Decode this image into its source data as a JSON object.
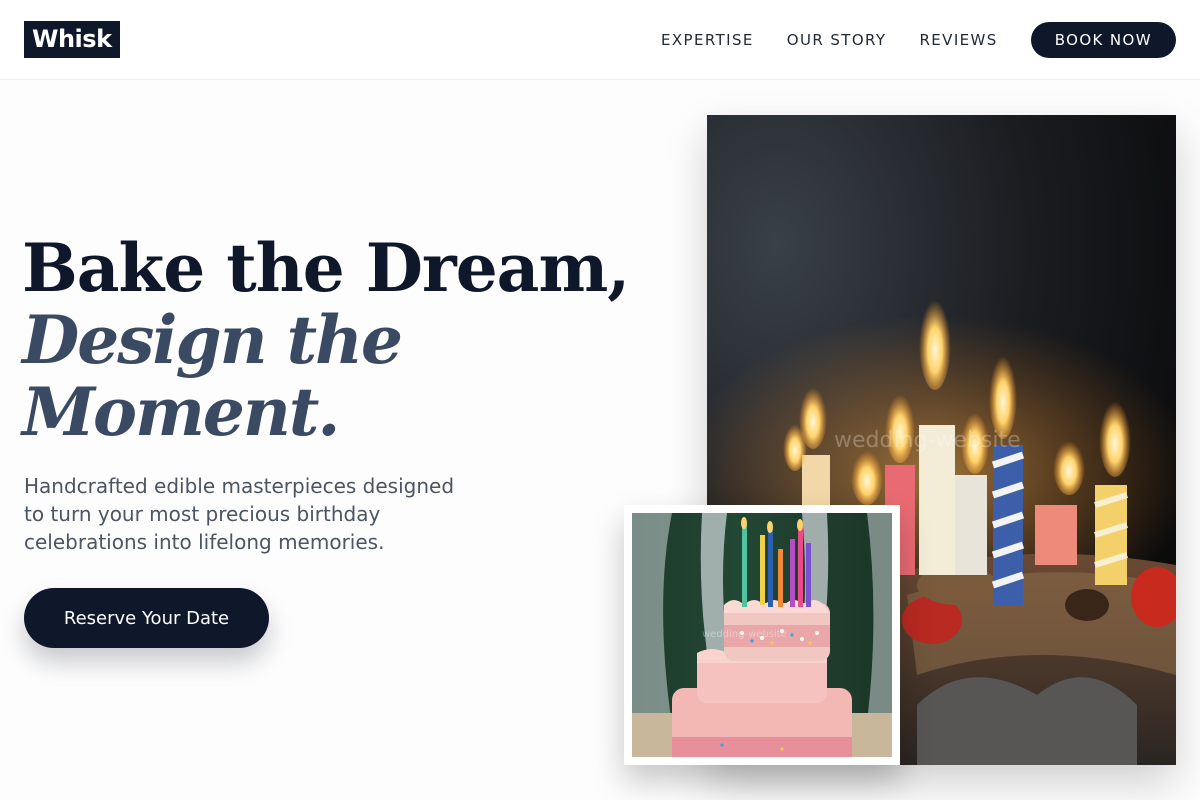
{
  "brand": {
    "logo_text": "Whisk",
    "primary_color": "#0f172a"
  },
  "nav": {
    "links": [
      {
        "label": "EXPERTISE"
      },
      {
        "label": "OUR STORY"
      },
      {
        "label": "REVIEWS"
      }
    ],
    "cta_label": "BOOK NOW"
  },
  "hero": {
    "title_line1": "Bake the Dream,",
    "title_line2a": "Design the",
    "title_line2b": "Moment.",
    "subtitle": "Handcrafted edible masterpieces designed to turn your most precious birthday celebrations into lifelong memories.",
    "cta_label": "Reserve Your Date"
  },
  "images": {
    "main_photo": {
      "subject": "birthday-cake-with-lit-candles",
      "watermark": "wedding-website"
    },
    "inset_photo": {
      "subject": "pink-tiered-cake-with-candles",
      "watermark": "wedding-website"
    }
  }
}
